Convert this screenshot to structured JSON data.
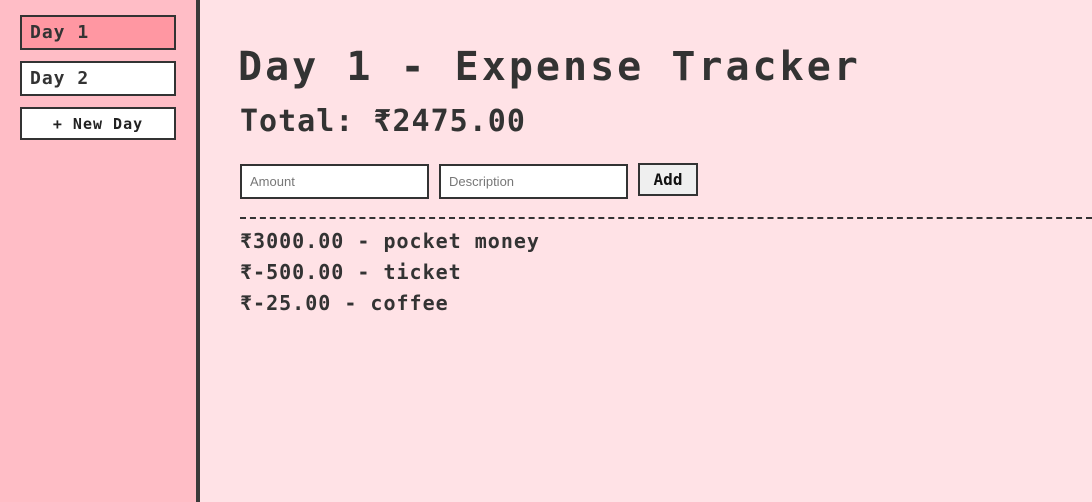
{
  "sidebar": {
    "days": [
      {
        "label": "Day 1",
        "active": true
      },
      {
        "label": "Day 2",
        "active": false
      }
    ],
    "new_day_label": "+ New Day"
  },
  "main": {
    "title": "Day 1 - Expense Tracker",
    "total_label": "Total: ₹2475.00",
    "form": {
      "amount_placeholder": "Amount",
      "amount_value": "",
      "description_placeholder": "Description",
      "description_value": "",
      "add_label": "Add"
    },
    "entries": [
      {
        "text": "₹3000.00 - pocket money"
      },
      {
        "text": "₹-500.00 - ticket"
      },
      {
        "text": "₹-25.00 - coffee"
      }
    ]
  },
  "colors": {
    "page_bg": "#ffe2e6",
    "sidebar_bg": "#ffbdc6",
    "active_day_bg": "#ff97a2",
    "border": "#333333"
  }
}
